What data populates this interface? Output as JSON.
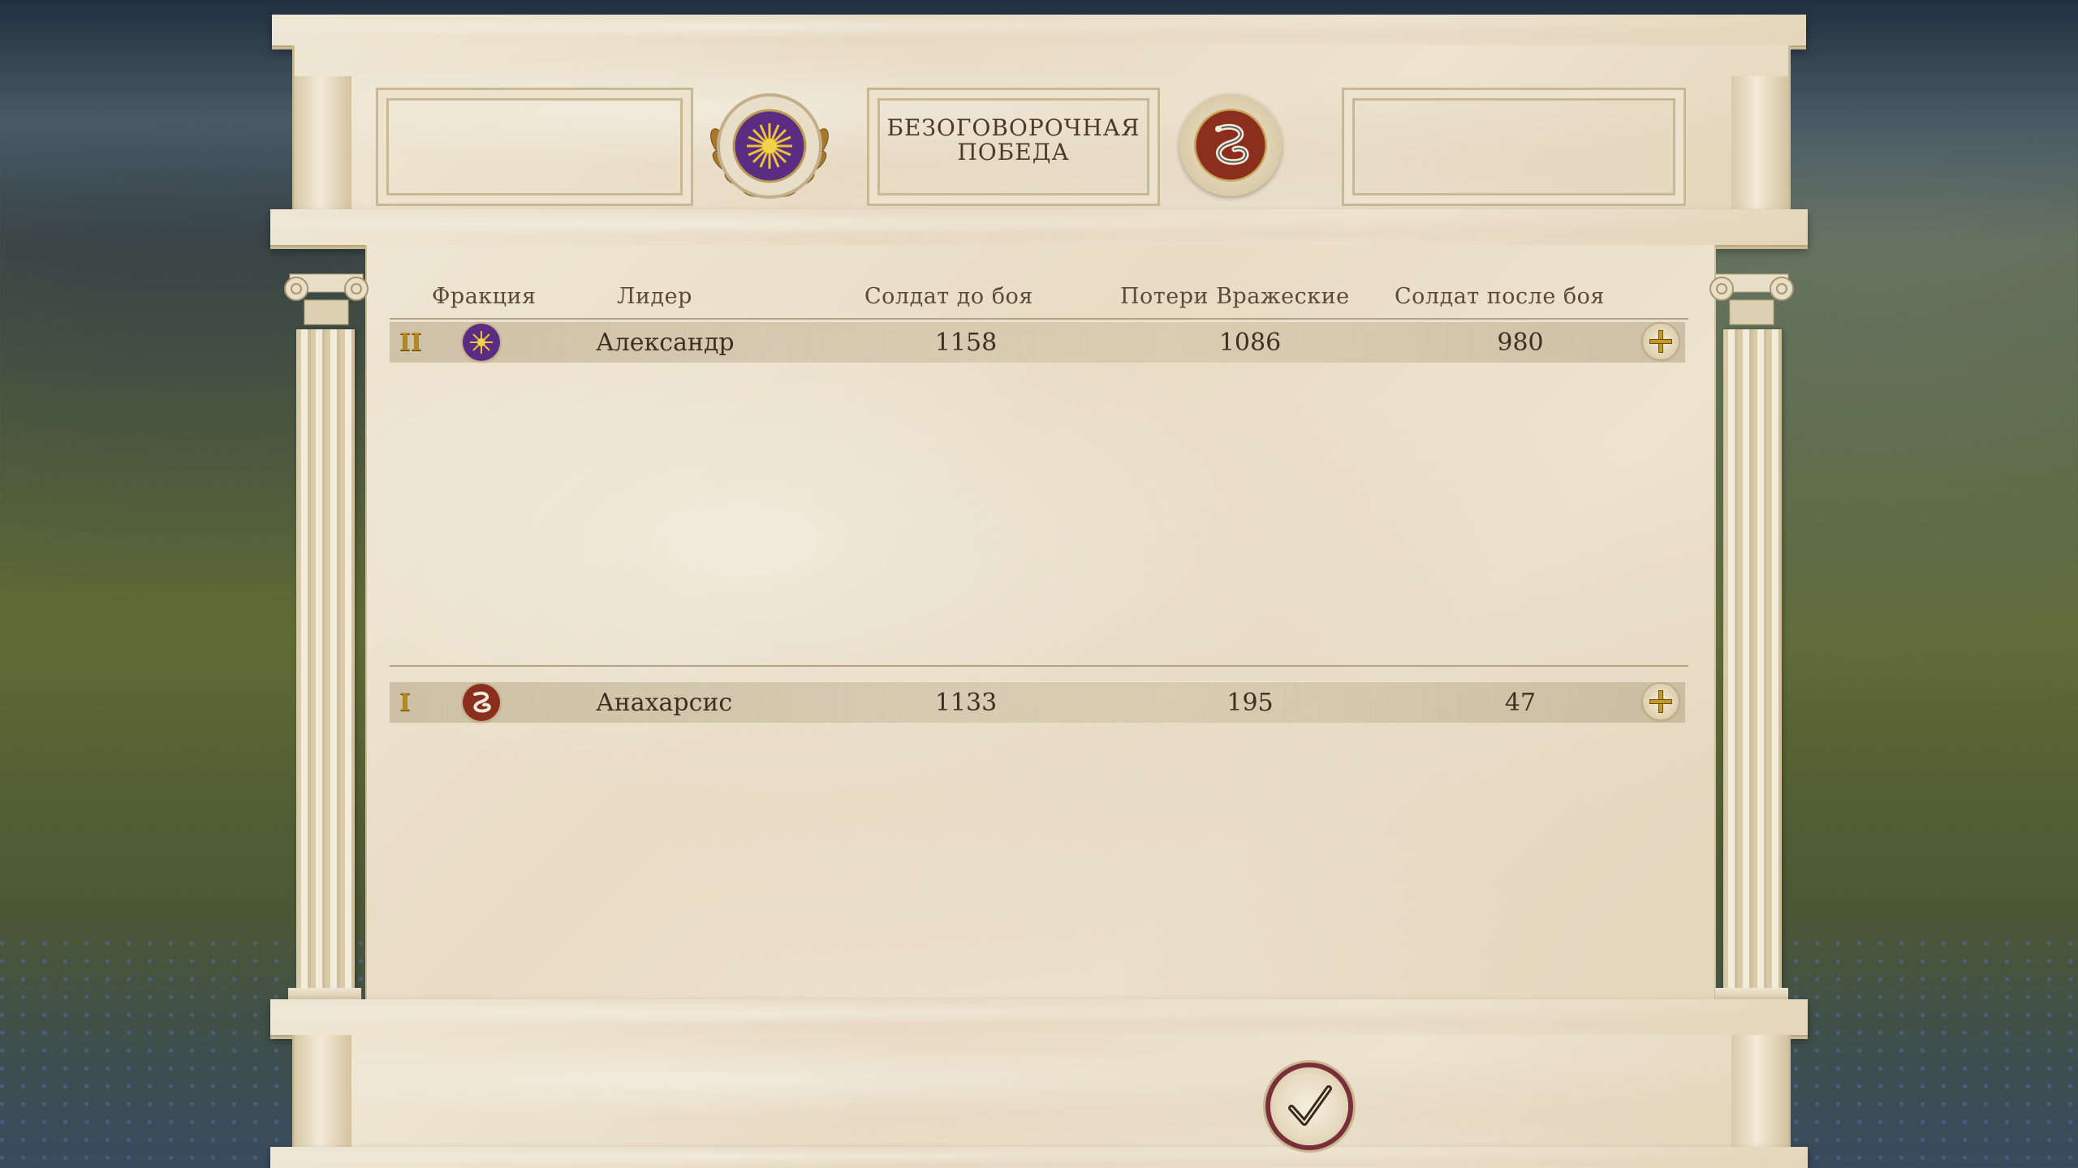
{
  "header": {
    "result_title_line1": "БЕЗОГОВОРОЧНАЯ",
    "result_title_line2": "ПОБЕДА",
    "left_emblem": "vergina-sun-emblem",
    "right_emblem": "serpent-emblem"
  },
  "table": {
    "columns": {
      "faction": "Фракция",
      "leader": "Лидер",
      "soldiers_before": "Солдат до боя",
      "enemy_losses": "Потери Вражеские",
      "soldiers_after": "Солдат после боя"
    },
    "rows": [
      {
        "rank": "II",
        "faction_icon": "vergina-sun-icon",
        "leader": "Александр",
        "soldiers_before": "1158",
        "enemy_losses": "1086",
        "soldiers_after": "980"
      },
      {
        "rank": "I",
        "faction_icon": "serpent-icon",
        "leader": "Анахарсис",
        "soldiers_before": "1133",
        "enemy_losses": "195",
        "soldiers_after": "47"
      }
    ]
  },
  "footer": {
    "confirm_icon": "checkmark-icon"
  },
  "colors": {
    "macedon_purple": "#5b2d82",
    "scythian_red": "#8a2e1e",
    "gold": "#c49a25",
    "marble": "#ece2cd"
  }
}
